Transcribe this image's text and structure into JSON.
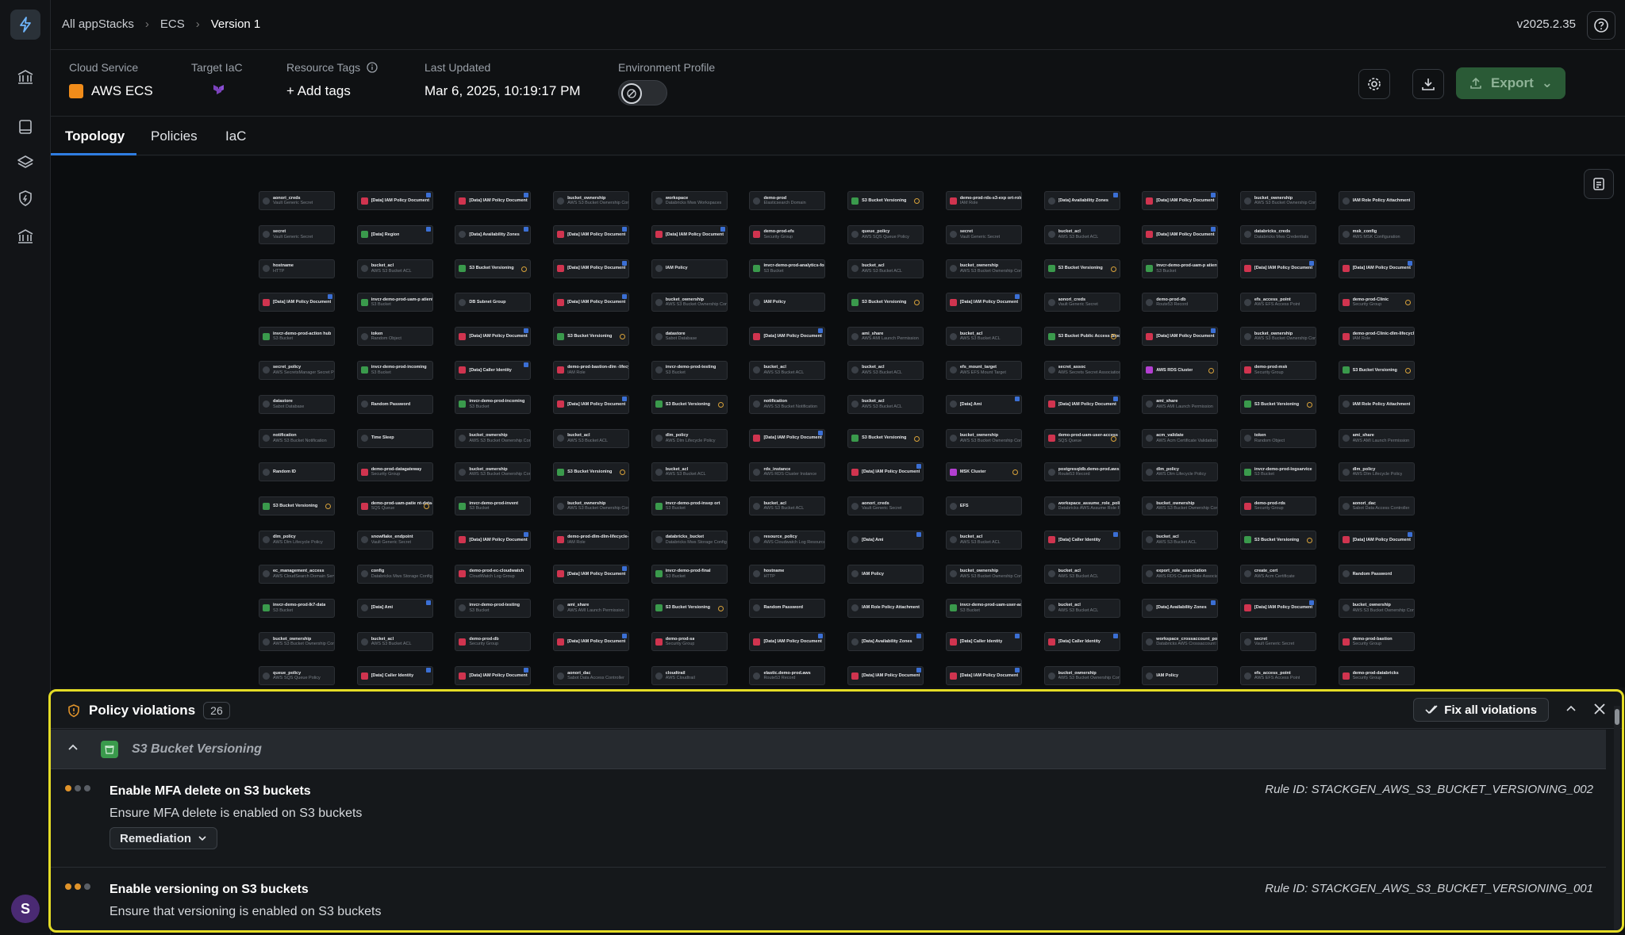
{
  "breadcrumbs": [
    "All appStacks",
    "ECS",
    "Version 1"
  ],
  "app_version": "v2025.2.35",
  "user_initial": "S",
  "info": {
    "cloud_service_label": "Cloud Service",
    "cloud_service_value": "AWS ECS",
    "target_iac_label": "Target IaC",
    "resource_tags_label": "Resource Tags",
    "add_tags": "+ Add tags",
    "last_updated_label": "Last Updated",
    "last_updated_value": "Mar 6, 2025, 10:19:17 PM",
    "env_profile_label": "Environment Profile",
    "export_label": "Export"
  },
  "tabs": [
    "Topology",
    "Policies",
    "IaC"
  ],
  "topology": {
    "nodes": [
      {
        "t": "aonori_creds",
        "s": "Vault Generic Secret",
        "k": "n"
      },
      {
        "t": "[Data] IAM Policy Document",
        "s": "",
        "k": "r",
        "b": 1
      },
      {
        "t": "[Data] IAM Policy Document",
        "s": "",
        "k": "r",
        "b": 1
      },
      {
        "t": "bucket_ownership",
        "s": "AWS S3 Bucket Ownership Controls",
        "k": "n"
      },
      {
        "t": "workspace",
        "s": "Databricks Mws Workspaces",
        "k": "n"
      },
      {
        "t": "demo-prod",
        "s": "Elasticsearch Domain",
        "k": "n"
      },
      {
        "t": "S3 Bucket Versioning",
        "s": "",
        "k": "g",
        "w": 1
      },
      {
        "t": "demo-prod-rds-s3-exp ort-role",
        "s": "IAM Role",
        "k": "r"
      },
      {
        "t": "[Data] Availability Zones",
        "s": "",
        "k": "n",
        "b": 1
      },
      {
        "t": "[Data] IAM Policy Document",
        "s": "",
        "k": "r",
        "b": 1
      },
      {
        "t": "bucket_ownership",
        "s": "AWS S3 Bucket Ownership Controls",
        "k": "n"
      },
      {
        "t": "IAM Role Policy Attachment",
        "s": "",
        "k": "n"
      },
      {
        "t": "secret",
        "s": "Vault Generic Secret",
        "k": "n"
      },
      {
        "t": "[Data] Region",
        "s": "",
        "k": "g",
        "b": 1
      },
      {
        "t": "[Data] Availability Zones",
        "s": "",
        "k": "n",
        "b": 1
      },
      {
        "t": "[Data] IAM Policy Document",
        "s": "",
        "k": "r",
        "b": 1
      },
      {
        "t": "[Data] IAM Policy Document",
        "s": "",
        "k": "r",
        "b": 1
      },
      {
        "t": "demo-prod-efs",
        "s": "Security Group",
        "k": "r"
      },
      {
        "t": "queue_policy",
        "s": "AWS SQS Queue Policy",
        "k": "n"
      },
      {
        "t": "secret",
        "s": "Vault Generic Secret",
        "k": "n"
      },
      {
        "t": "bucket_acl",
        "s": "AWS S3 Bucket ACL",
        "k": "n"
      },
      {
        "t": "[Data] IAM Policy Document",
        "s": "",
        "k": "r",
        "b": 1
      },
      {
        "t": "databricks_creds",
        "s": "Databricks Mws Credentials",
        "k": "n"
      },
      {
        "t": "msk_config",
        "s": "AWS MSK Configuration",
        "k": "n"
      },
      {
        "t": "hostname",
        "s": "HTTP",
        "k": "n"
      },
      {
        "t": "bucket_acl",
        "s": "AWS S3 Bucket ACL",
        "k": "n"
      },
      {
        "t": "S3 Bucket Versioning",
        "s": "",
        "k": "g",
        "w": 1
      },
      {
        "t": "[Data] IAM Policy Document",
        "s": "",
        "k": "r",
        "b": 1
      },
      {
        "t": "IAM Policy",
        "s": "",
        "k": "n"
      },
      {
        "t": "invcr-demo-prod-analytics-form",
        "s": "S3 Bucket",
        "k": "g"
      },
      {
        "t": "bucket_acl",
        "s": "AWS S3 Bucket ACL",
        "k": "n"
      },
      {
        "t": "bucket_ownership",
        "s": "AWS S3 Bucket Ownership Controls",
        "k": "n"
      },
      {
        "t": "S3 Bucket Versioning",
        "s": "",
        "k": "g",
        "w": 1
      },
      {
        "t": "invcr-demo-prod-uam-p atient-data-processed",
        "s": "S3 Bucket",
        "k": "g"
      },
      {
        "t": "[Data] IAM Policy Document",
        "s": "",
        "k": "r",
        "b": 1
      },
      {
        "t": "[Data] IAM Policy Document",
        "s": "",
        "k": "r",
        "b": 1
      },
      {
        "t": "[Data] IAM Policy Document",
        "s": "",
        "k": "r",
        "b": 1
      },
      {
        "t": "invcr-demo-prod-uam-p atient-data-raw",
        "s": "S3 Bucket",
        "k": "g"
      },
      {
        "t": "DB Subnet Group",
        "s": "",
        "k": "n"
      },
      {
        "t": "[Data] IAM Policy Document",
        "s": "",
        "k": "r",
        "b": 1
      },
      {
        "t": "bucket_ownership",
        "s": "AWS S3 Bucket Ownership Controls",
        "k": "n"
      },
      {
        "t": "IAM Policy",
        "s": "",
        "k": "n"
      },
      {
        "t": "S3 Bucket Versioning",
        "s": "",
        "k": "g",
        "w": 1
      },
      {
        "t": "[Data] IAM Policy Document",
        "s": "",
        "k": "r",
        "b": 1
      },
      {
        "t": "aonori_creds",
        "s": "Vault Generic Secret",
        "k": "n"
      },
      {
        "t": "demo-prod-db",
        "s": "Route53 Record",
        "k": "n"
      },
      {
        "t": "efs_access_point",
        "s": "AWS EFS Access Point",
        "k": "n"
      },
      {
        "t": "demo-prod-Clinic",
        "s": "Security Group",
        "k": "r",
        "w": 1
      },
      {
        "t": "invcr-demo-prod-action hub",
        "s": "S3 Bucket",
        "k": "g"
      },
      {
        "t": "token",
        "s": "Random Object",
        "k": "n"
      },
      {
        "t": "[Data] IAM Policy Document",
        "s": "",
        "k": "r",
        "b": 1
      },
      {
        "t": "S3 Bucket Versioning",
        "s": "",
        "k": "g",
        "w": 1
      },
      {
        "t": "datastore",
        "s": "Sabot Database",
        "k": "n"
      },
      {
        "t": "[Data] IAM Policy Document",
        "s": "",
        "k": "r",
        "b": 1
      },
      {
        "t": "ami_share",
        "s": "AWS AMI Launch Permission",
        "k": "n"
      },
      {
        "t": "bucket_acl",
        "s": "AWS S3 Bucket ACL",
        "k": "n"
      },
      {
        "t": "S3 Bucket Public Access Block",
        "s": "",
        "k": "g",
        "w": 1
      },
      {
        "t": "[Data] IAM Policy Document",
        "s": "",
        "k": "r",
        "b": 1
      },
      {
        "t": "bucket_ownership",
        "s": "AWS S3 Bucket Ownership Controls",
        "k": "n"
      },
      {
        "t": "demo-prod-Clinic-dlm-lifecycle-role",
        "s": "IAM Role",
        "k": "r"
      },
      {
        "t": "secret_policy",
        "s": "AWS SecretsManager Secret Policy",
        "k": "n"
      },
      {
        "t": "invcr-demo-prod-incoming",
        "s": "S3 Bucket",
        "k": "g"
      },
      {
        "t": "[Data] Caller Identity",
        "s": "",
        "k": "r",
        "b": 1
      },
      {
        "t": "demo-prod-bastion-dlm -lifecycle-role",
        "s": "IAM Role",
        "k": "r"
      },
      {
        "t": "invcr-demo-prod-testing",
        "s": "S3 Bucket",
        "k": "n"
      },
      {
        "t": "bucket_acl",
        "s": "AWS S3 Bucket ACL",
        "k": "n"
      },
      {
        "t": "bucket_acl",
        "s": "AWS S3 Bucket ACL",
        "k": "n"
      },
      {
        "t": "efs_mount_target",
        "s": "AWS EFS Mount Target",
        "k": "n"
      },
      {
        "t": "secret_assoc",
        "s": "AWS Secrets Secret Association",
        "k": "n"
      },
      {
        "t": "AWS RDS Cluster",
        "s": "",
        "k": "p",
        "w": 1
      },
      {
        "t": "demo-prod-msk",
        "s": "Security Group",
        "k": "r"
      },
      {
        "t": "S3 Bucket Versioning",
        "s": "",
        "k": "g",
        "w": 1
      },
      {
        "t": "datastore",
        "s": "Sabot Database",
        "k": "n"
      },
      {
        "t": "Random Password",
        "s": "",
        "k": "n"
      },
      {
        "t": "invcr-demo-prod-incoming",
        "s": "S3 Bucket",
        "k": "g"
      },
      {
        "t": "[Data] IAM Policy Document",
        "s": "",
        "k": "r",
        "b": 1
      },
      {
        "t": "S3 Bucket Versioning",
        "s": "",
        "k": "g",
        "w": 1
      },
      {
        "t": "notification",
        "s": "AWS S3 Bucket Notification",
        "k": "n"
      },
      {
        "t": "bucket_acl",
        "s": "AWS S3 Bucket ACL",
        "k": "n"
      },
      {
        "t": "[Data] Ami",
        "s": "",
        "k": "n",
        "b": 1
      },
      {
        "t": "[Data] IAM Policy Document",
        "s": "",
        "k": "r",
        "b": 1
      },
      {
        "t": "ami_share",
        "s": "AWS AMI Launch Permission",
        "k": "n"
      },
      {
        "t": "S3 Bucket Versioning",
        "s": "",
        "k": "g",
        "w": 1
      },
      {
        "t": "IAM Role Policy Attachment",
        "s": "",
        "k": "n"
      },
      {
        "t": "notification",
        "s": "AWS S3 Bucket Notification",
        "k": "n"
      },
      {
        "t": "Time Sleep",
        "s": "",
        "k": "n"
      },
      {
        "t": "bucket_ownership",
        "s": "AWS S3 Bucket Ownership Controls",
        "k": "n"
      },
      {
        "t": "bucket_acl",
        "s": "AWS S3 Bucket ACL",
        "k": "n"
      },
      {
        "t": "dlm_policy",
        "s": "AWS Dlm Lifecycle Policy",
        "k": "n"
      },
      {
        "t": "[Data] IAM Policy Document",
        "s": "",
        "k": "r",
        "b": 1
      },
      {
        "t": "S3 Bucket Versioning",
        "s": "",
        "k": "g",
        "w": 1
      },
      {
        "t": "bucket_ownership",
        "s": "AWS S3 Bucket Ownership Controls",
        "k": "n"
      },
      {
        "t": "demo-prod-uam-user-access",
        "s": "SQS Queue",
        "k": "r",
        "w": 1
      },
      {
        "t": "acm_validate",
        "s": "AWS Acm Certificate Validation",
        "k": "n"
      },
      {
        "t": "token",
        "s": "Random Object",
        "k": "n"
      },
      {
        "t": "ami_share",
        "s": "AWS AMI Launch Permission",
        "k": "n"
      },
      {
        "t": "Random ID",
        "s": "",
        "k": "n"
      },
      {
        "t": "demo-prod-datagateway",
        "s": "Security Group",
        "k": "r"
      },
      {
        "t": "bucket_ownership",
        "s": "AWS S3 Bucket Ownership Controls",
        "k": "n"
      },
      {
        "t": "S3 Bucket Versioning",
        "s": "",
        "k": "g",
        "w": 1
      },
      {
        "t": "bucket_acl",
        "s": "AWS S3 Bucket ACL",
        "k": "n"
      },
      {
        "t": "rds_instance",
        "s": "AWS RDS Cluster Instance",
        "k": "n"
      },
      {
        "t": "[Data] IAM Policy Document",
        "s": "",
        "k": "r",
        "b": 1
      },
      {
        "t": "MSK Cluster",
        "s": "",
        "k": "p",
        "w": 1
      },
      {
        "t": "postgresqldb.demo-prod.aws",
        "s": "Route53 Record",
        "k": "n"
      },
      {
        "t": "dlm_policy",
        "s": "AWS Dlm Lifecycle Policy",
        "k": "n"
      },
      {
        "t": "invcr-demo-prod-logsarvice",
        "s": "S3 Bucket",
        "k": "g"
      },
      {
        "t": "dlm_policy",
        "s": "AWS Dlm Lifecycle Policy",
        "k": "n"
      },
      {
        "t": "S3 Bucket Versioning",
        "s": "",
        "k": "g",
        "w": 1
      },
      {
        "t": "demo-prod-uam-patie nt-data-processed",
        "s": "SQS Queue",
        "k": "r",
        "w": 1
      },
      {
        "t": "invcr-demo-prod-invent",
        "s": "S3 Bucket",
        "k": "g"
      },
      {
        "t": "bucket_ownership",
        "s": "AWS S3 Bucket Ownership Controls",
        "k": "n"
      },
      {
        "t": "invcr-demo-prod-insep ort",
        "s": "S3 Bucket",
        "k": "g"
      },
      {
        "t": "bucket_acl",
        "s": "AWS S3 Bucket ACL",
        "k": "n"
      },
      {
        "t": "aonori_creds",
        "s": "Vault Generic Secret",
        "k": "n"
      },
      {
        "t": "EFS",
        "s": "",
        "k": "n"
      },
      {
        "t": "workspace_assume_role_policy",
        "s": "Databricks AWS Assume Role Policy",
        "k": "n"
      },
      {
        "t": "bucket_ownership",
        "s": "AWS S3 Bucket Ownership Controls",
        "k": "n"
      },
      {
        "t": "demo-prod-rds",
        "s": "Security Group",
        "k": "r"
      },
      {
        "t": "aonori_dac",
        "s": "Sabot Data Access Controller",
        "k": "n"
      },
      {
        "t": "dlm_policy",
        "s": "AWS Dlm Lifecycle Policy",
        "k": "n"
      },
      {
        "t": "snowflake_endpoint",
        "s": "Vault Generic Secret",
        "k": "n"
      },
      {
        "t": "[Data] IAM Policy Document",
        "s": "",
        "k": "r",
        "b": 1
      },
      {
        "t": "demo-prod-dlm-dlm-lifecycle-role",
        "s": "IAM Role",
        "k": "r"
      },
      {
        "t": "databricks_bucket",
        "s": "Databricks Mws Storage Config",
        "k": "n"
      },
      {
        "t": "resource_policy",
        "s": "AWS Cloudwatch Log Resource Policy",
        "k": "n"
      },
      {
        "t": "[Data] Ami",
        "s": "",
        "k": "n",
        "b": 1
      },
      {
        "t": "bucket_acl",
        "s": "AWS S3 Bucket ACL",
        "k": "n"
      },
      {
        "t": "[Data] Caller Identity",
        "s": "",
        "k": "r",
        "b": 1
      },
      {
        "t": "bucket_acl",
        "s": "AWS S3 Bucket ACL",
        "k": "n"
      },
      {
        "t": "S3 Bucket Versioning",
        "s": "",
        "k": "g",
        "w": 1
      },
      {
        "t": "[Data] IAM Policy Document",
        "s": "",
        "k": "r",
        "b": 1
      },
      {
        "t": "ec_management_access",
        "s": "AWS CloudSearch Domain Service Policy",
        "k": "n"
      },
      {
        "t": "config",
        "s": "Databricks Mws Storage Configurations",
        "k": "n"
      },
      {
        "t": "demo-prod-ec-cloudwatch",
        "s": "CloudWatch Log Group",
        "k": "r"
      },
      {
        "t": "[Data] IAM Policy Document",
        "s": "",
        "k": "r",
        "b": 1
      },
      {
        "t": "invcr-demo-prod-final",
        "s": "S3 Bucket",
        "k": "g"
      },
      {
        "t": "hostname",
        "s": "HTTP",
        "k": "n"
      },
      {
        "t": "IAM Policy",
        "s": "",
        "k": "n"
      },
      {
        "t": "bucket_ownership",
        "s": "AWS S3 Bucket Ownership Controls",
        "k": "n"
      },
      {
        "t": "bucket_acl",
        "s": "AWS S3 Bucket ACL",
        "k": "n"
      },
      {
        "t": "export_role_association",
        "s": "AWS RDS Cluster Role Association",
        "k": "n"
      },
      {
        "t": "create_cert",
        "s": "AWS Acm Certificate",
        "k": "n"
      },
      {
        "t": "Random Password",
        "s": "",
        "k": "n"
      },
      {
        "t": "invcr-demo-prod-lk7-data",
        "s": "S3 Bucket",
        "k": "g"
      },
      {
        "t": "[Data] Ami",
        "s": "",
        "k": "n",
        "b": 1
      },
      {
        "t": "invcr-demo-prod-testing",
        "s": "S3 Bucket",
        "k": "n"
      },
      {
        "t": "ami_share",
        "s": "AWS AMI Launch Permission",
        "k": "n"
      },
      {
        "t": "S3 Bucket Versioning",
        "s": "",
        "k": "g",
        "w": 1
      },
      {
        "t": "Random Password",
        "s": "",
        "k": "n"
      },
      {
        "t": "IAM Role Policy Attachment",
        "s": "",
        "k": "n"
      },
      {
        "t": "invcr-demo-prod-uam-user-access",
        "s": "S3 Bucket",
        "k": "g"
      },
      {
        "t": "bucket_acl",
        "s": "AWS S3 Bucket ACL",
        "k": "n"
      },
      {
        "t": "[Data] Availability Zones",
        "s": "",
        "k": "n",
        "b": 1
      },
      {
        "t": "[Data] IAM Policy Document",
        "s": "",
        "k": "r",
        "b": 1
      },
      {
        "t": "bucket_ownership",
        "s": "AWS S3 Bucket Ownership Controls",
        "k": "n"
      },
      {
        "t": "bucket_ownership",
        "s": "AWS S3 Bucket Ownership Controls",
        "k": "n"
      },
      {
        "t": "bucket_acl",
        "s": "AWS S3 Bucket ACL",
        "k": "n"
      },
      {
        "t": "demo-prod-db",
        "s": "Security Group",
        "k": "r"
      },
      {
        "t": "[Data] IAM Policy Document",
        "s": "",
        "k": "r",
        "b": 1
      },
      {
        "t": "demo-prod-sa",
        "s": "Security Group",
        "k": "r"
      },
      {
        "t": "[Data] IAM Policy Document",
        "s": "",
        "k": "r",
        "b": 1
      },
      {
        "t": "[Data] Availability Zones",
        "s": "",
        "k": "n",
        "b": 1
      },
      {
        "t": "[Data] Caller Identity",
        "s": "",
        "k": "r",
        "b": 1
      },
      {
        "t": "[Data] Caller Identity",
        "s": "",
        "k": "r",
        "b": 1
      },
      {
        "t": "workspace_crossaccount_policy",
        "s": "Databricks AWS Crossaccount Policy",
        "k": "n"
      },
      {
        "t": "secret",
        "s": "Vault Generic Secret",
        "k": "n"
      },
      {
        "t": "demo-prod-bastion",
        "s": "Security Group",
        "k": "r"
      },
      {
        "t": "queue_policy",
        "s": "AWS SQS Queue Policy",
        "k": "n"
      },
      {
        "t": "[Data] Caller Identity",
        "s": "",
        "k": "r",
        "b": 1
      },
      {
        "t": "[Data] IAM Policy Document",
        "s": "",
        "k": "r",
        "b": 1
      },
      {
        "t": "aonori_dac",
        "s": "Sabot Data Access Controller",
        "k": "n"
      },
      {
        "t": "cloudtrail",
        "s": "AWS Cloudtrail",
        "k": "n"
      },
      {
        "t": "elastic.demo-prod.aws",
        "s": "Route53 Record",
        "k": "n"
      },
      {
        "t": "[Data] IAM Policy Document",
        "s": "",
        "k": "r",
        "b": 1
      },
      {
        "t": "[Data] IAM Policy Document",
        "s": "",
        "k": "r",
        "b": 1
      },
      {
        "t": "bucket_ownership",
        "s": "AWS S3 Bucket Ownership Controls",
        "k": "n"
      },
      {
        "t": "IAM Policy",
        "s": "",
        "k": "n"
      },
      {
        "t": "efs_access_point",
        "s": "AWS EFS Access Point",
        "k": "n"
      },
      {
        "t": "demo-prod-databricks",
        "s": "Security Group",
        "k": "r"
      }
    ]
  },
  "policy_panel": {
    "title": "Policy violations",
    "count": "26",
    "fix_all": "Fix all violations",
    "group_label": "S3 Bucket Versioning",
    "violations": [
      {
        "title": "Enable MFA delete on S3 buckets",
        "desc": "Ensure MFA delete is enabled on S3 buckets",
        "rule": "Rule ID: STACKGEN_AWS_S3_BUCKET_VERSIONING_002",
        "remediation": "Remediation"
      },
      {
        "title": "Enable versioning on S3 buckets",
        "desc": "Ensure that versioning is enabled on S3 buckets",
        "rule": "Rule ID: STACKGEN_AWS_S3_BUCKET_VERSIONING_001"
      }
    ]
  }
}
